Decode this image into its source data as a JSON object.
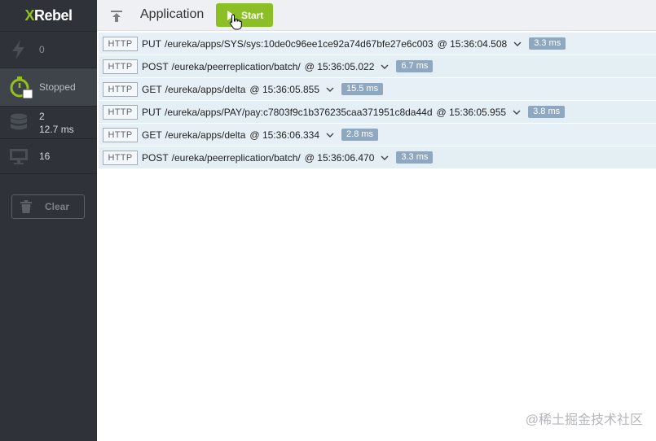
{
  "sidebar": {
    "logo_x": "X",
    "logo_rest": "Rebel",
    "requests_count": "0",
    "status_label": "Stopped",
    "db_count": "2",
    "db_time": "12.7 ms",
    "monitor_count": "16",
    "clear_label": "Clear"
  },
  "toolbar": {
    "title": "Application",
    "start_label": "Start"
  },
  "requests": [
    {
      "type": "HTTP",
      "method": "PUT",
      "path": "/eureka/apps/SYS/sys:10de0c96ee1ce92a74d67bfe27e6c003",
      "time": "@ 15:36:04.508",
      "duration": "3.3 ms"
    },
    {
      "type": "HTTP",
      "method": "POST",
      "path": "/eureka/peerreplication/batch/",
      "time": "@ 15:36:05.022",
      "duration": "6.7 ms"
    },
    {
      "type": "HTTP",
      "method": "GET",
      "path": "/eureka/apps/delta",
      "time": "@ 15:36:05.855",
      "duration": "15.5 ms"
    },
    {
      "type": "HTTP",
      "method": "PUT",
      "path": "/eureka/apps/PAY/pay:c7803f9c1b376235caa371951c8da44d",
      "time": "@ 15:36:05.955",
      "duration": "3.8 ms"
    },
    {
      "type": "HTTP",
      "method": "GET",
      "path": "/eureka/apps/delta",
      "time": "@ 15:36:06.334",
      "duration": "2.8 ms"
    },
    {
      "type": "HTTP",
      "method": "POST",
      "path": "/eureka/peerreplication/batch/",
      "time": "@ 15:36:06.470",
      "duration": "3.3 ms"
    }
  ],
  "watermark": "@稀土掘金技术社区",
  "colors": {
    "accent_green": "#8bbf25",
    "sidebar_bg": "#2f3238",
    "row_bg": "#e3eef5",
    "duration_badge": "#8fa7bf"
  }
}
